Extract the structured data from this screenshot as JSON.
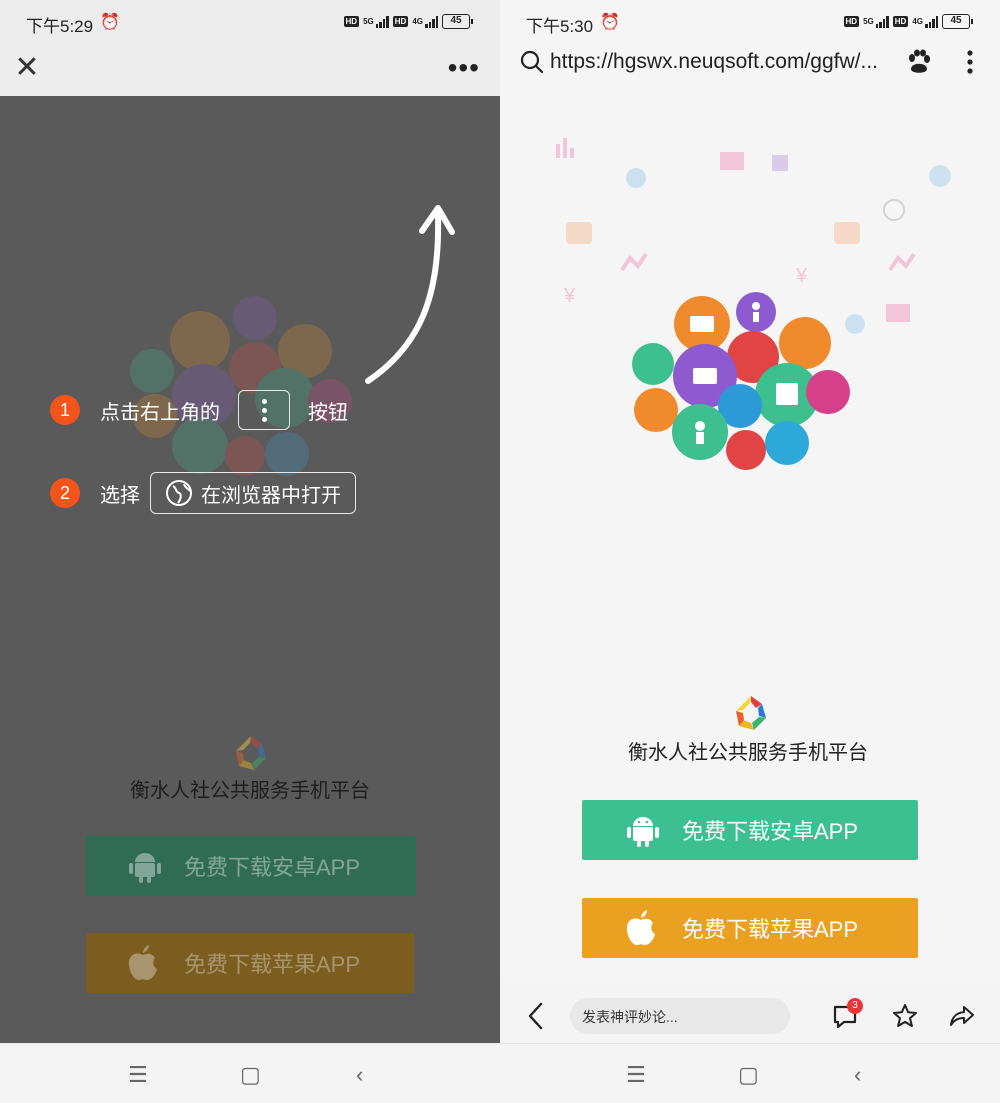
{
  "colors": {
    "android_green": "#3dc091",
    "apple_orange": "#eaa122",
    "step_orange": "#f2541b",
    "overlay_gray": "#5a5a5a",
    "badge_red": "#e8363a"
  },
  "left": {
    "status": {
      "time": "下午5:29",
      "battery": "45",
      "net1": "5G",
      "net2": "4G",
      "hd": "HD"
    },
    "topbar": {
      "close_icon": "close-icon",
      "more_icon": "more-horizontal-icon"
    },
    "guide": {
      "step1": {
        "num": "1",
        "text_before": "点击右上角的",
        "text_after": "按钮"
      },
      "step2": {
        "num": "2",
        "text": "选择",
        "button_label": "在浏览器中打开"
      }
    },
    "app_title": "衡水人社公共服务手机平台",
    "android_label": "免费下载安卓APP",
    "ios_label": "免费下载苹果APP"
  },
  "right": {
    "status": {
      "time": "下午5:30",
      "battery": "45",
      "net1": "5G",
      "net2": "4G",
      "hd": "HD"
    },
    "url": "https://hgswx.neuqsoft.com/ggfw/...",
    "app_title": "衡水人社公共服务手机平台",
    "android_label": "免费下载安卓APP",
    "ios_label": "免费下载苹果APP",
    "comment_placeholder": "发表神评妙论...",
    "comment_count": "3"
  },
  "icons": [
    "search-icon",
    "baidu-paw-icon",
    "kebab-menu-icon",
    "android-icon",
    "apple-icon",
    "back-icon",
    "comment-icon",
    "star-icon",
    "share-icon",
    "menu-nav-icon",
    "home-nav-icon",
    "back-nav-icon",
    "globe-icon",
    "arrow-icon"
  ]
}
